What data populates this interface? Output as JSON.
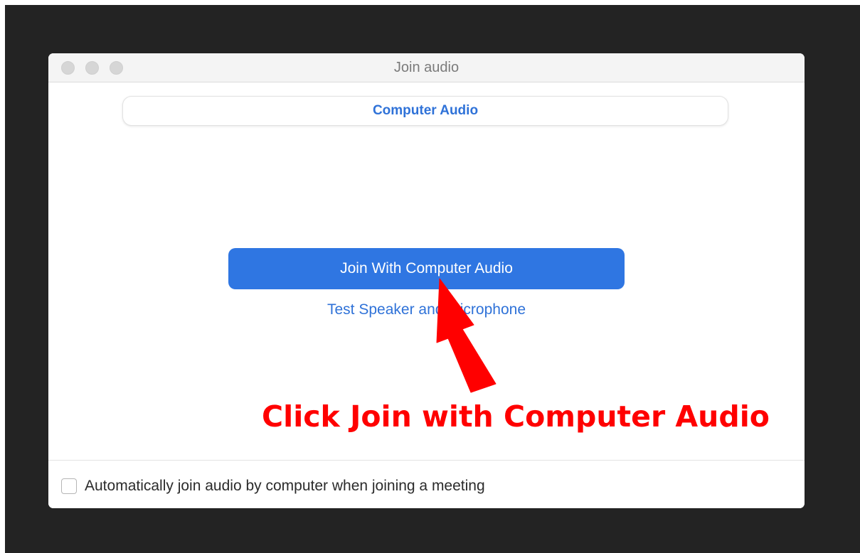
{
  "window": {
    "title": "Join audio"
  },
  "tabs": [
    {
      "label": "Computer Audio",
      "active": true
    }
  ],
  "main": {
    "join_button_label": "Join With Computer Audio",
    "test_link_label": "Test Speaker and Microphone"
  },
  "footer": {
    "auto_join_label": "Automatically join audio by computer when joining a meeting",
    "auto_join_checked": false
  },
  "annotation": {
    "text": "Click Join with Computer Audio",
    "color": "#ff0000",
    "arrow_icon": "red-arrow-icon"
  },
  "colors": {
    "accent": "#2f76e2",
    "link": "#2f72d8",
    "backdrop": "#232323"
  }
}
